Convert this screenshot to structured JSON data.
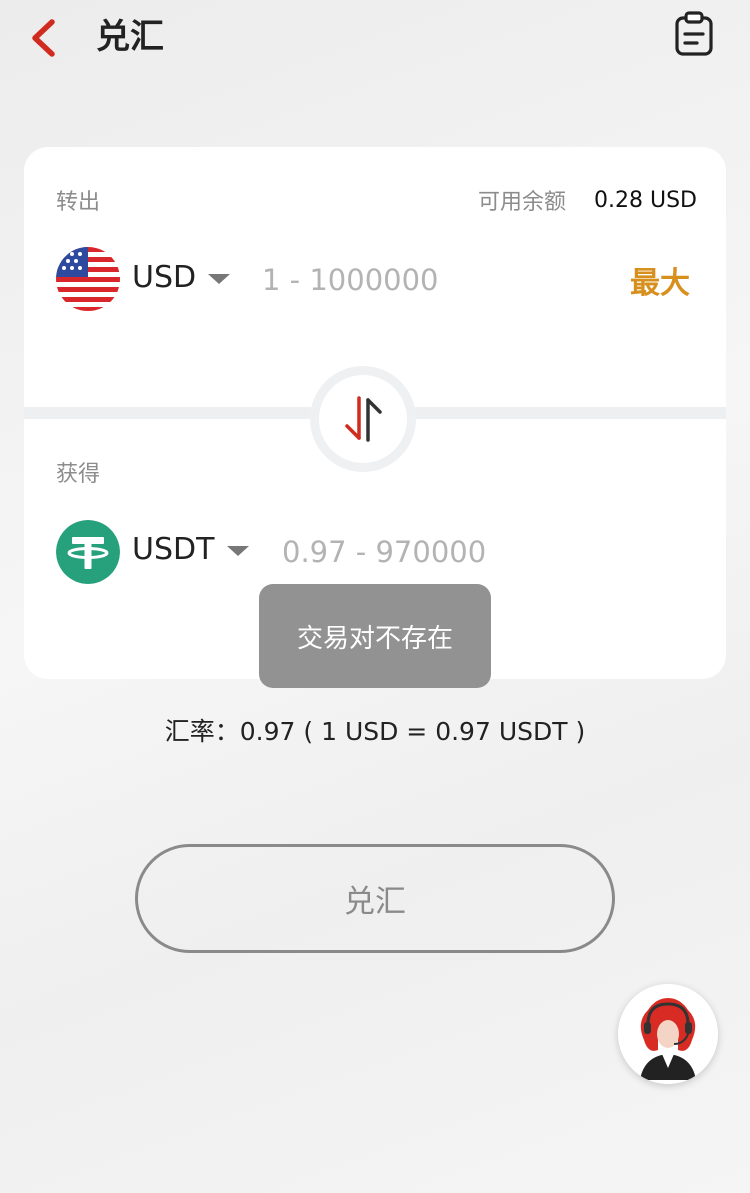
{
  "header": {
    "title": "兑汇",
    "back_icon": "chevron-left-icon",
    "record_icon": "clipboard-icon"
  },
  "from": {
    "label": "转出",
    "balance_label": "可用余额",
    "balance_value": "0.28 USD",
    "currency": "USD",
    "currency_icon": "us-flag-icon",
    "amount_placeholder": "1 - 1000000",
    "max_label": "最大"
  },
  "to": {
    "label": "获得",
    "currency": "USDT",
    "currency_icon": "tether-icon",
    "amount_placeholder": "0.97 - 970000"
  },
  "toast": {
    "message": "交易对不存在"
  },
  "rate": {
    "text": "汇率：0.97 ( 1 USD = 0.97 USDT )"
  },
  "exchange_button": {
    "label": "兑汇"
  },
  "support": {
    "icon": "customer-service-avatar-icon"
  },
  "colors": {
    "accent_red": "#d12a1f",
    "max_orange": "#d7901d",
    "tether_green": "#26a17b",
    "toast_gray": "#929292"
  }
}
